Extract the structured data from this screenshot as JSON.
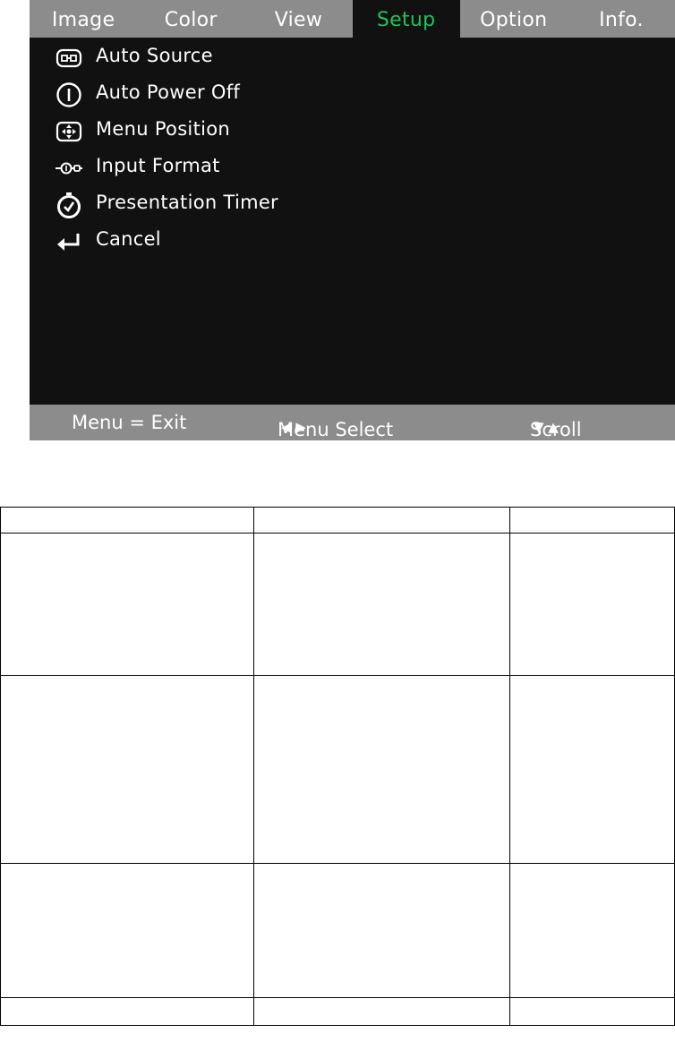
{
  "osd": {
    "tabs": [
      {
        "label": "Image",
        "active": false
      },
      {
        "label": "Color",
        "active": false
      },
      {
        "label": "View",
        "active": false
      },
      {
        "label": "Setup",
        "active": true
      },
      {
        "label": "Option",
        "active": false
      },
      {
        "label": "Info.",
        "active": false
      }
    ],
    "menu_items": [
      {
        "label": "Auto Source",
        "icon": "auto-source-icon"
      },
      {
        "label": "Auto Power Off",
        "icon": "power-icon"
      },
      {
        "label": "Menu Position",
        "icon": "menu-position-icon"
      },
      {
        "label": "Input Format",
        "icon": "input-format-icon"
      },
      {
        "label": "Presentation Timer",
        "icon": "timer-icon"
      },
      {
        "label": "Cancel",
        "icon": "return-arrow-icon"
      }
    ],
    "footer": {
      "exit": "Menu = Exit",
      "select": "Menu Select",
      "select_glyphs": "◀ ▶",
      "scroll": "Scroll",
      "scroll_glyphs": "▼ ▲"
    },
    "colors": {
      "background": "#111111",
      "bar": "#8c8c8c",
      "active_tab_text": "#1fc25a",
      "text": "#ffffff"
    }
  },
  "table": {
    "rows": [
      [
        "",
        "",
        ""
      ],
      [
        "",
        "",
        ""
      ],
      [
        "",
        "",
        ""
      ],
      [
        "",
        "",
        ""
      ],
      [
        "",
        "",
        ""
      ]
    ]
  }
}
